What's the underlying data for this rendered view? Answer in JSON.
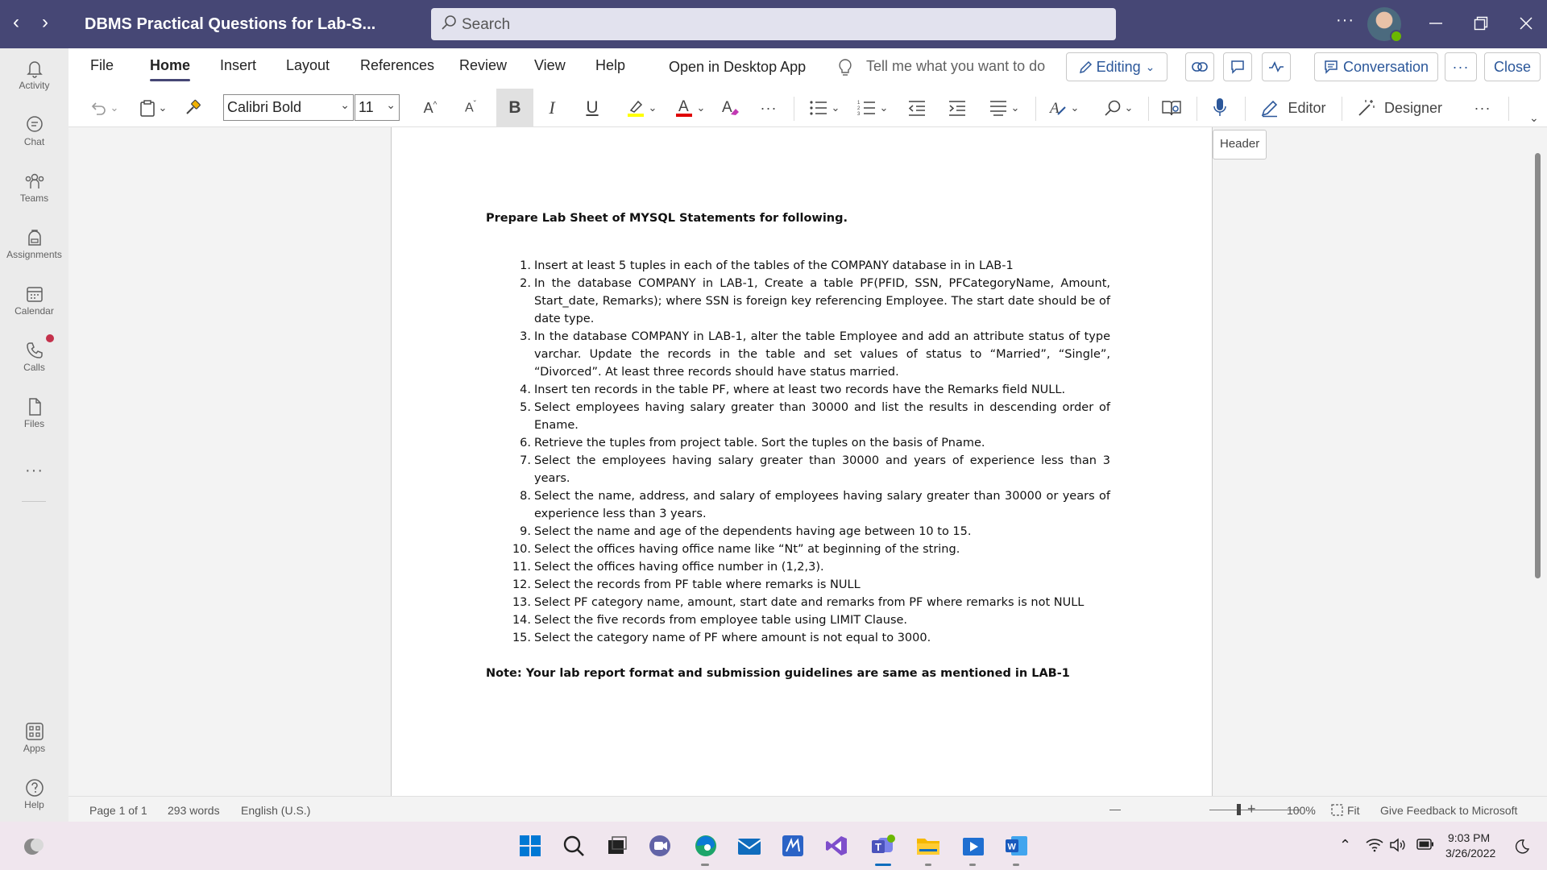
{
  "window": {
    "title": "DBMS Practical Questions for Lab-S...",
    "search_placeholder": "Search",
    "more": "···"
  },
  "rail": [
    {
      "label": "Activity",
      "icon": "bell-icon"
    },
    {
      "label": "Chat",
      "icon": "chat-icon"
    },
    {
      "label": "Teams",
      "icon": "teams-icon"
    },
    {
      "label": "Assignments",
      "icon": "backpack-icon"
    },
    {
      "label": "Calendar",
      "icon": "calendar-icon"
    },
    {
      "label": "Calls",
      "icon": "phone-icon"
    },
    {
      "label": "Files",
      "icon": "file-icon"
    },
    {
      "label": "Apps",
      "icon": "apps-icon"
    },
    {
      "label": "Help",
      "icon": "help-icon"
    }
  ],
  "ribbon": {
    "tabs": [
      "File",
      "Home",
      "Insert",
      "Layout",
      "References",
      "Review",
      "View",
      "Help",
      "Open in Desktop App"
    ],
    "active_tab": "Home",
    "tell_me": "Tell me what you want to do",
    "editing": "Editing",
    "conversation": "Conversation",
    "close": "Close",
    "more": "···",
    "font_name": "Calibri Bold",
    "font_size": "11",
    "editor": "Editor",
    "designer": "Designer",
    "accent_color": "#464775",
    "word_blue": "#2b579a"
  },
  "document": {
    "heading": "Prepare Lab Sheet of MYSQL Statements for following.",
    "items": [
      {
        "num": "1.",
        "text": "Insert at least 5 tuples in each of the tables of the COMPANY database in in LAB-1"
      },
      {
        "num": "2.",
        "text": "In the database COMPANY in LAB-1, Create a table PF(PFID, SSN, PFCategoryName, Amount, Start_date, Remarks); where SSN is foreign key referencing Employee. The start date should be of date type."
      },
      {
        "num": "3.",
        "text": "In the database COMPANY in LAB-1, alter the table Employee and add an attribute status of type varchar. Update the records in the table and set values of status to “Married”, “Single”, “Divorced”. At least three records should have status married."
      },
      {
        "num": "4.",
        "text": "Insert ten records in the table PF, where at least two records have the Remarks field NULL."
      },
      {
        "num": "5.",
        "text": "Select employees having salary greater than 30000 and list the results in descending order of Ename."
      },
      {
        "num": "6.",
        "text": "Retrieve the tuples from project table. Sort the tuples on the basis of Pname."
      },
      {
        "num": "7.",
        "text": "Select the employees having salary greater than 30000 and years of experience less than 3 years."
      },
      {
        "num": "8.",
        "text": "Select the name, address, and salary of employees having salary greater than 30000 or years of experience less than 3 years."
      },
      {
        "num": "9.",
        "text": "Select the name and age of the dependents having age between 10 to 15."
      },
      {
        "num": "10.",
        "text": "Select the offices having office name like “Nt” at beginning of the string."
      },
      {
        "num": "11.",
        "text": "Select the offices having office number in (1,2,3)."
      },
      {
        "num": "12.",
        "text": "Select the records from PF table where remarks is NULL"
      },
      {
        "num": "13.",
        "text": "Select PF category name, amount,  start date and remarks from PF where remarks is not NULL"
      },
      {
        "num": "14.",
        "text": "Select the five records from employee table using LIMIT Clause."
      },
      {
        "num": "15.",
        "text": "Select the category name of PF where amount is not equal to 3000."
      }
    ],
    "note": "Note: Your lab report format and submission guidelines are same as mentioned in LAB-1",
    "header_tag": "Header"
  },
  "statusbar": {
    "page": "Page 1 of 1",
    "words": "293 words",
    "language": "English (U.S.)",
    "zoom_minus": "—",
    "zoom_plus": "+",
    "zoom": "100%",
    "fit": "Fit",
    "feedback": "Give Feedback to Microsoft"
  },
  "taskbar": {
    "time": "9:03 PM",
    "date": "3/26/2022"
  }
}
